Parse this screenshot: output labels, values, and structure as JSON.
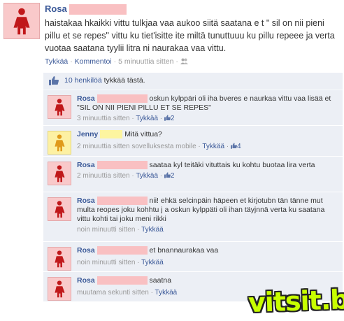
{
  "post": {
    "author": "Rosa",
    "text": "haistakaa hkaikki vittu tulkjaa vaa aukoo siitä saatana e t \" sil on nii pieni pillu et se repes\" vittu ku tiet'isitte ite miltä tunuttuuu ku pillu repeee ja verta vuotaa saatana tyylii litra ni naurakaa vaa vittu.",
    "like_label": "Tykkää",
    "comment_label": "Kommentoi",
    "time": "5 minuuttia sitten",
    "sep": "·"
  },
  "likes": {
    "count_text": "10 henkilöä",
    "rest_text": "tykkää tästä."
  },
  "comments": [
    {
      "author": "Rosa",
      "text": "oskun kylppäri oli iha bveres e naurkaa vittu vaa lisää et \"SIL ON NII PIENI PILLU ET SE REPES\"",
      "time": "3 minuuttia sitten",
      "like_label": "Tykkää",
      "likes": "2"
    },
    {
      "author": "Jenny",
      "text": "Mitä vittua?",
      "time": "2 minuuttia sitten sovelluksesta mobile",
      "like_label": "Tykkää",
      "likes": "4"
    },
    {
      "author": "Rosa",
      "text": "saataa kyl teitäki vituttais ku kohtu buotaa lira verta",
      "time": "2 minuuttia sitten",
      "like_label": "Tykkää",
      "likes": "2"
    },
    {
      "author": "Rosa",
      "text": "nii! ehkä selcinpäin häpeen et kirjotubn tän tänne mut multa reopes joku kohhtu j a oskun kylppäti oli ihan täyjnnä verta ku saatana vittu kohti tai joku meni rikki",
      "time": "noin minuutti sitten",
      "like_label": "Tykkää"
    },
    {
      "author": "Rosa",
      "text": "et bnannaurakaa vaa",
      "time": "noin minuutti sitten",
      "like_label": "Tykkää"
    },
    {
      "author": "Rosa",
      "text": "saatna",
      "time": "muutama sekunti sitten",
      "like_label": "Tykkää"
    }
  ],
  "watermark": "vitsit.biz",
  "colors": {
    "link": "#3b5998",
    "avatar_pink": "#f9c9ca",
    "avatar_yellow": "#fdf1a3",
    "watermark": "#c8ff00"
  }
}
